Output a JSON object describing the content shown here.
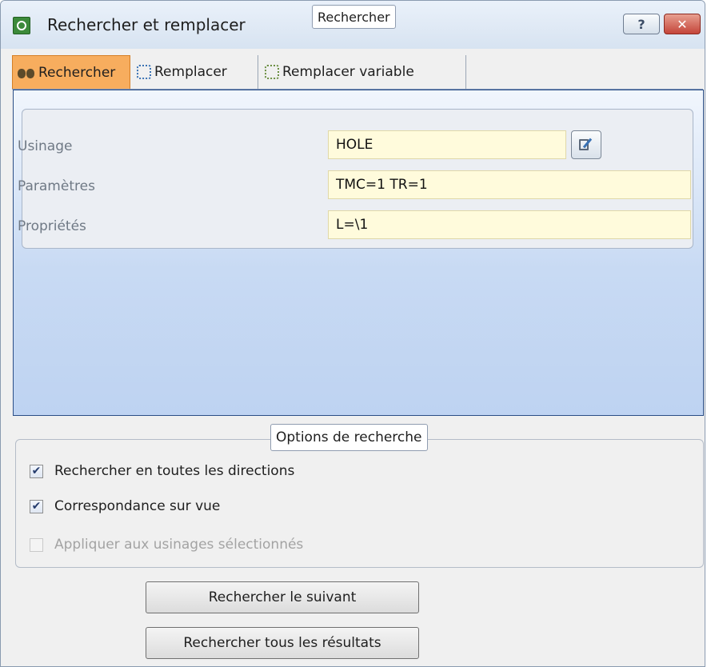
{
  "window": {
    "title": "Rechercher et remplacer",
    "help_label": "?",
    "close_label": "✕"
  },
  "tabs": [
    {
      "label": "Rechercher",
      "icon": "binoculars-icon",
      "active": true
    },
    {
      "label": "Remplacer",
      "icon": "replace-icon",
      "active": false
    },
    {
      "label": "Remplacer variable",
      "icon": "replace-variable-icon",
      "active": false
    }
  ],
  "search_group": {
    "caption": "Rechercher",
    "rows": [
      {
        "label": "Usinage",
        "value": "HOLE"
      },
      {
        "label": "Paramètres",
        "value": "TMC=1 TR=1"
      },
      {
        "label": "Propriétés",
        "value": "L=\\1"
      }
    ]
  },
  "options": {
    "caption": "Options de recherche",
    "items": [
      {
        "label": "Rechercher en toutes les directions",
        "checked": true,
        "enabled": true
      },
      {
        "label": "Correspondance sur vue",
        "checked": true,
        "enabled": true
      },
      {
        "label": "Appliquer aux usinages sélectionnés",
        "checked": false,
        "enabled": false
      }
    ]
  },
  "buttons": {
    "find_next": "Rechercher le suivant",
    "find_all": "Rechercher tous les résultats"
  },
  "check_mark": "✔",
  "colors": {
    "active_tab": "#f7ad5e",
    "field_bg": "#fffbdc",
    "pane_gradient_end": "#bed3f2"
  }
}
